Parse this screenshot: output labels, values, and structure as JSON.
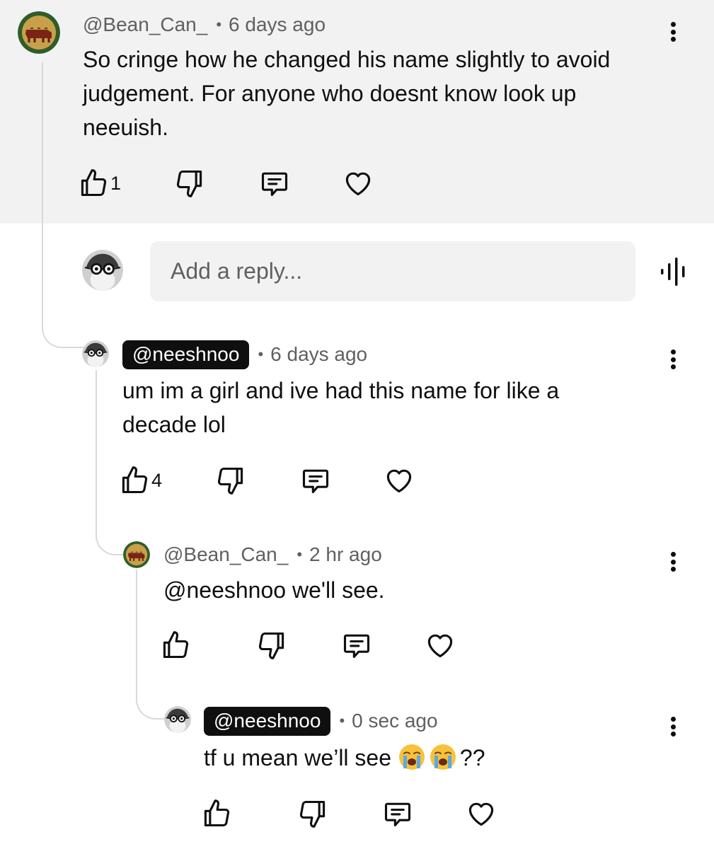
{
  "comments": [
    {
      "handle": "@Bean_Can_",
      "time": "6 days ago",
      "text_lines": [
        "So cringe how he changed his name slightly to avoid",
        "judgement. For anyone who doesnt know look up",
        "neeuish."
      ],
      "likes": "1"
    },
    {
      "handle": "@neeshnoo",
      "time": "6 days ago",
      "text_lines": [
        "um im a girl and ive had this name for like a",
        "decade lol"
      ],
      "likes": "4"
    },
    {
      "handle": "@Bean_Can_",
      "time": "2 hr ago",
      "text_lines": [
        "@neeshnoo we'll see."
      ],
      "likes": ""
    },
    {
      "handle": "@neeshnoo",
      "time": "0 sec ago",
      "text_prefix": "tf u mean we’ll see ",
      "text_suffix": "??",
      "likes": ""
    }
  ],
  "reply_box": {
    "placeholder": "Add a reply..."
  },
  "separator": "•",
  "icons": {
    "like": "thumbs-up-icon",
    "dislike": "thumbs-down-icon",
    "reply": "comment-icon",
    "heart": "heart-icon",
    "more": "more-vertical-icon",
    "voice": "voice-search-icon",
    "emoji": "loudly-crying-face-emoji"
  },
  "colors": {
    "highlight": "#f2f2f2",
    "text": "#0f0f0f",
    "muted": "#606060",
    "pill": "#0f0f0f"
  }
}
